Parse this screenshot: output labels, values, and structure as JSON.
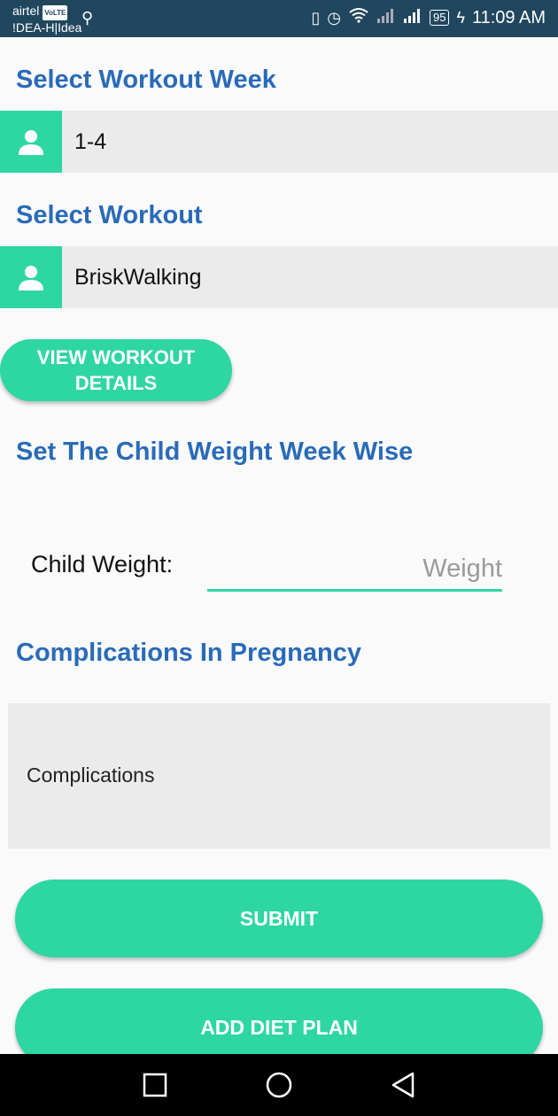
{
  "status_bar": {
    "carrier_primary": "airtel",
    "volte_badge": "VoLTE",
    "carrier_secondary": "!DEA-H|Idea",
    "battery_level": "95",
    "time": "11:09 AM",
    "icons": [
      "usb-icon",
      "vibrate-icon",
      "alarm-icon",
      "wifi-icon",
      "signal-icon",
      "signal-icon",
      "battery-icon",
      "charging-icon"
    ]
  },
  "workout_week": {
    "title": "Select Workout Week",
    "icon": "person-icon",
    "selected_value": "1-4"
  },
  "workout": {
    "title": "Select Workout",
    "icon": "person-icon",
    "selected_value": "BriskWalking"
  },
  "view_details_button": {
    "label_line1": "VIEW WORKOUT",
    "label_line2": "DETAILS"
  },
  "child_weight": {
    "title": "Set The Child Weight Week Wise",
    "label": "Child Weight:",
    "input_value": "",
    "placeholder": "Weight"
  },
  "complications": {
    "title": "Complications In Pregnancy",
    "input_value": "",
    "placeholder": "Complications"
  },
  "submit_button": {
    "label": "SUBMIT"
  },
  "add_diet_plan_button": {
    "label": "ADD DIET PLAN"
  },
  "colors": {
    "accent": "#2ed6a2",
    "title_blue": "#2a6bb8",
    "status_bar": "#21475e",
    "field_bg": "#ebebeb"
  },
  "nav_bar": {
    "icons": [
      "recents-icon",
      "home-icon",
      "back-icon"
    ]
  }
}
